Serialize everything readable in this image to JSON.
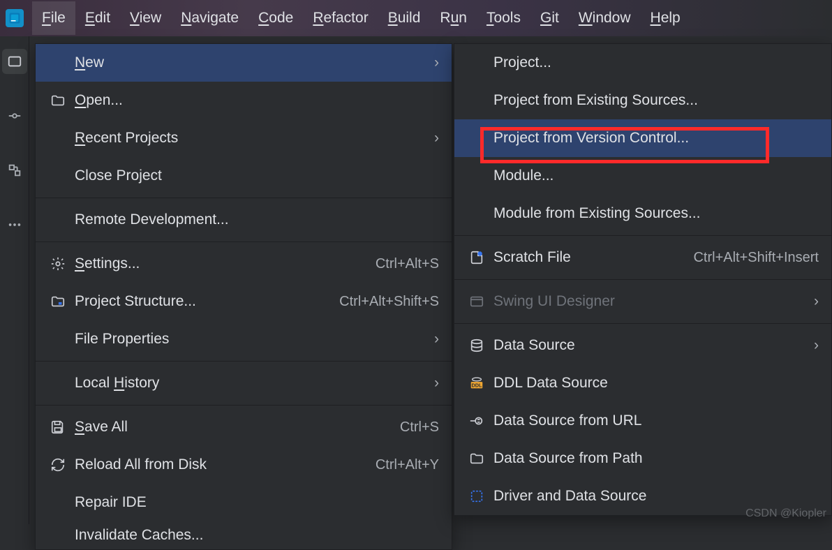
{
  "menubar": {
    "items": [
      {
        "label": "File",
        "mnemonic": "F"
      },
      {
        "label": "Edit",
        "mnemonic": "E"
      },
      {
        "label": "View",
        "mnemonic": "V"
      },
      {
        "label": "Navigate",
        "mnemonic": "N"
      },
      {
        "label": "Code",
        "mnemonic": "C"
      },
      {
        "label": "Refactor",
        "mnemonic": "R"
      },
      {
        "label": "Build",
        "mnemonic": "B"
      },
      {
        "label": "Run",
        "mnemonic": "u"
      },
      {
        "label": "Tools",
        "mnemonic": "T"
      },
      {
        "label": "Git",
        "mnemonic": "G"
      },
      {
        "label": "Window",
        "mnemonic": "W"
      },
      {
        "label": "Help",
        "mnemonic": "H"
      }
    ]
  },
  "file_menu": {
    "items": [
      {
        "label": "New",
        "mnemonic": "N",
        "arrow": true,
        "highlighted": true
      },
      {
        "label": "Open...",
        "mnemonic": "O",
        "icon": "folder"
      },
      {
        "label": "Recent Projects",
        "mnemonic": "R",
        "arrow": true
      },
      {
        "label": "Close Project"
      },
      {
        "sep": true
      },
      {
        "label": "Remote Development..."
      },
      {
        "sep": true
      },
      {
        "label": "Settings...",
        "mnemonic": "S",
        "icon": "gear",
        "shortcut": "Ctrl+Alt+S"
      },
      {
        "label": "Project Structure...",
        "icon": "proj-struct",
        "shortcut": "Ctrl+Alt+Shift+S"
      },
      {
        "label": "File Properties",
        "arrow": true
      },
      {
        "sep": true
      },
      {
        "label": "Local History",
        "mnemonic": "H",
        "arrow": true
      },
      {
        "sep": true
      },
      {
        "label": "Save All",
        "mnemonic": "S",
        "icon": "save",
        "shortcut": "Ctrl+S"
      },
      {
        "label": "Reload All from Disk",
        "icon": "reload",
        "shortcut": "Ctrl+Alt+Y"
      },
      {
        "label": "Repair IDE"
      },
      {
        "label": "Invalidate Caches..."
      }
    ]
  },
  "new_submenu": {
    "items": [
      {
        "label": "Project..."
      },
      {
        "label": "Project from Existing Sources..."
      },
      {
        "label": "Project from Version Control...",
        "highlighted": true,
        "redbox": true
      },
      {
        "label": "Module..."
      },
      {
        "label": "Module from Existing Sources..."
      },
      {
        "sep": true
      },
      {
        "label": "Scratch File",
        "icon": "scratch",
        "shortcut": "Ctrl+Alt+Shift+Insert"
      },
      {
        "sep": true
      },
      {
        "label": "Swing UI Designer",
        "icon": "window",
        "disabled": true,
        "arrow": true
      },
      {
        "sep": true
      },
      {
        "label": "Data Source",
        "icon": "db",
        "arrow": true
      },
      {
        "label": "DDL Data Source",
        "icon": "ddl"
      },
      {
        "label": "Data Source from URL",
        "icon": "plug"
      },
      {
        "label": "Data Source from Path",
        "icon": "folder"
      },
      {
        "label": "Driver and Data Source",
        "icon": "driver"
      }
    ]
  },
  "watermark": "CSDN @Kiopler"
}
